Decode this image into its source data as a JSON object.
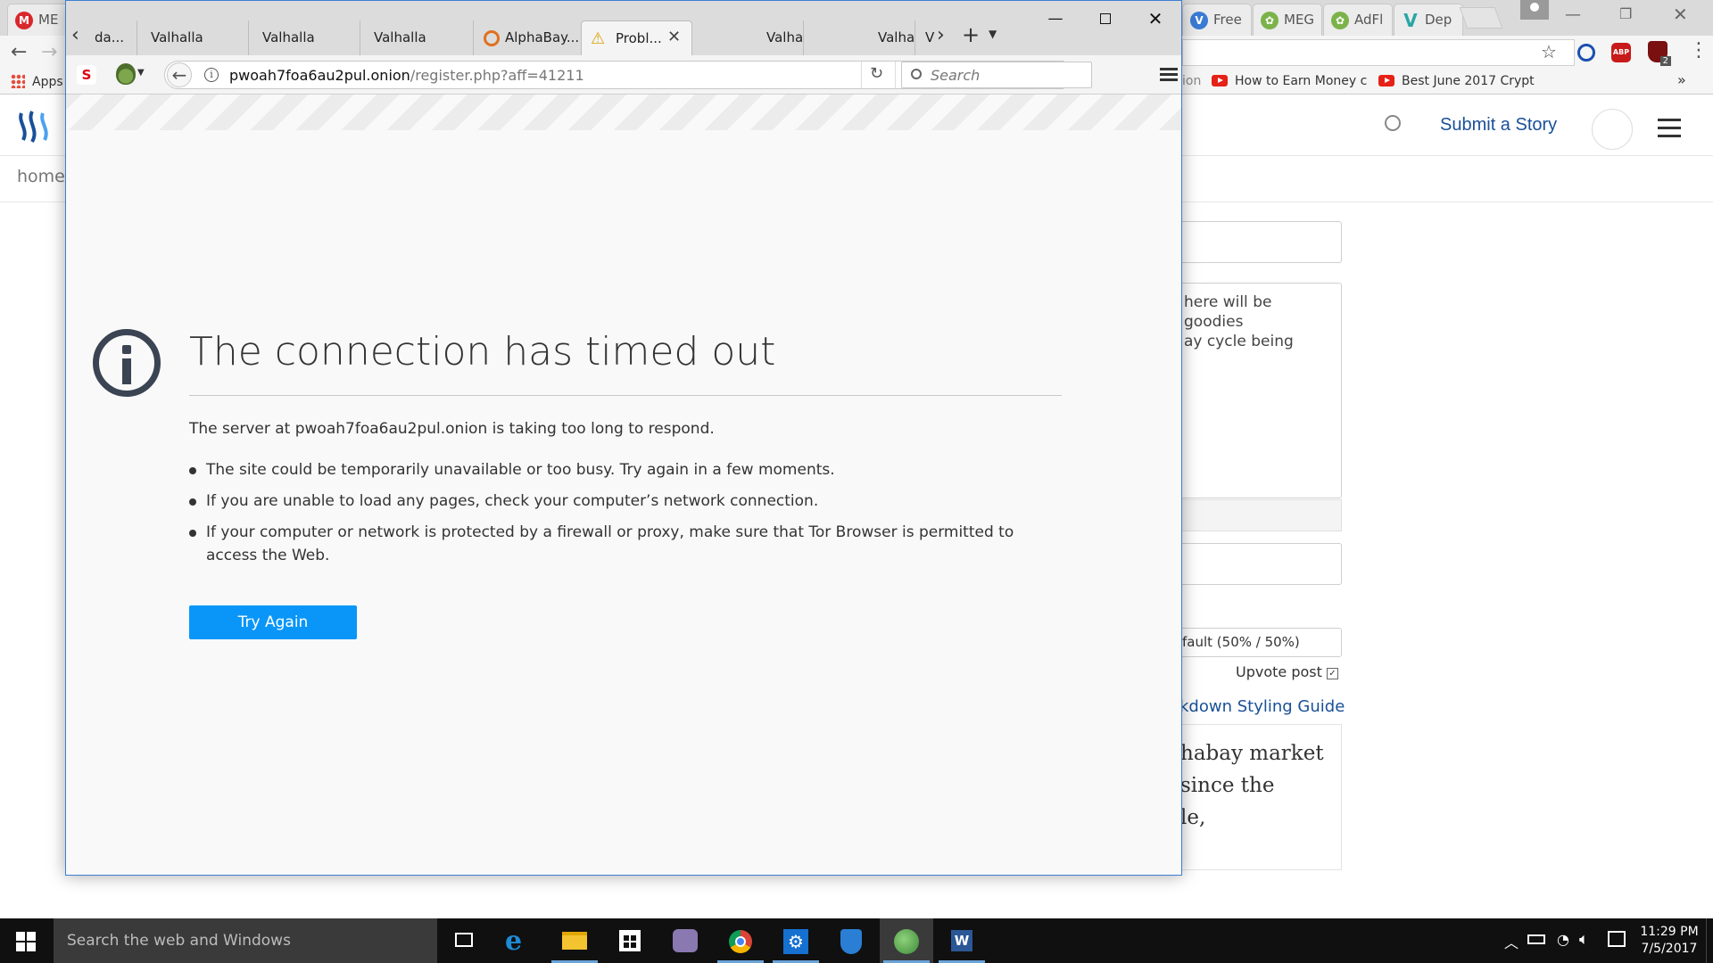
{
  "chrome": {
    "tabs": [
      {
        "label": "ME",
        "icon": "mega-icon"
      },
      {
        "label": "Free",
        "icon": "v-icon"
      },
      {
        "label": "MEG",
        "icon": "plant-icon"
      },
      {
        "label": "AdFl",
        "icon": "plant-icon"
      },
      {
        "label": "Dep",
        "icon": "v-icon"
      }
    ],
    "bookmarks": {
      "apps_label": "Apps",
      "items": [
        {
          "label": "ion"
        },
        {
          "label": "How to Earn Money c"
        },
        {
          "label": "Best June 2017 Crypt"
        }
      ],
      "overflow": "»"
    },
    "extension_badge": "2"
  },
  "steemit": {
    "submit_label": "Submit a Story",
    "nav_home": "home",
    "body_text_lines": [
      "here will be goodies",
      "ay cycle being"
    ],
    "payout_option": "fault (50% / 50%)",
    "upvote_label": "Upvote post",
    "markdown_link": "kdown Styling Guide",
    "preview_lines": [
      "habay market",
      "since the",
      "le,"
    ]
  },
  "tor": {
    "tabs": [
      {
        "label": "da..."
      },
      {
        "label": "Valhalla"
      },
      {
        "label": "Valhalla"
      },
      {
        "label": "Valhalla"
      },
      {
        "label": "AlphaBay..."
      },
      {
        "label": "Probl..."
      },
      {
        "label": "Valhalla"
      },
      {
        "label": "Valhalla"
      },
      {
        "label": "V"
      }
    ],
    "url_host": "pwoah7foa6au2pul.onion",
    "url_path": "/register.php?aff=41211",
    "search_placeholder": "Search",
    "error": {
      "title": "The connection has timed out",
      "description": "The server at pwoah7foa6au2pul.onion is taking too long to respond.",
      "bullets": [
        "The site could be temporarily unavailable or too busy. Try again in a few moments.",
        "If you are unable to load any pages, check your computer’s network connection.",
        "If your computer or network is protected by a firewall or proxy, make sure that Tor Browser is permitted to access the Web."
      ],
      "button_label": "Try Again"
    }
  },
  "taskbar": {
    "search_placeholder": "Search the web and Windows",
    "time": "11:29 PM",
    "date": "7/5/2017"
  },
  "colors": {
    "accent": "#0996f8",
    "steemit_blue": "#1a5099",
    "error_icon": "#3b4452"
  }
}
